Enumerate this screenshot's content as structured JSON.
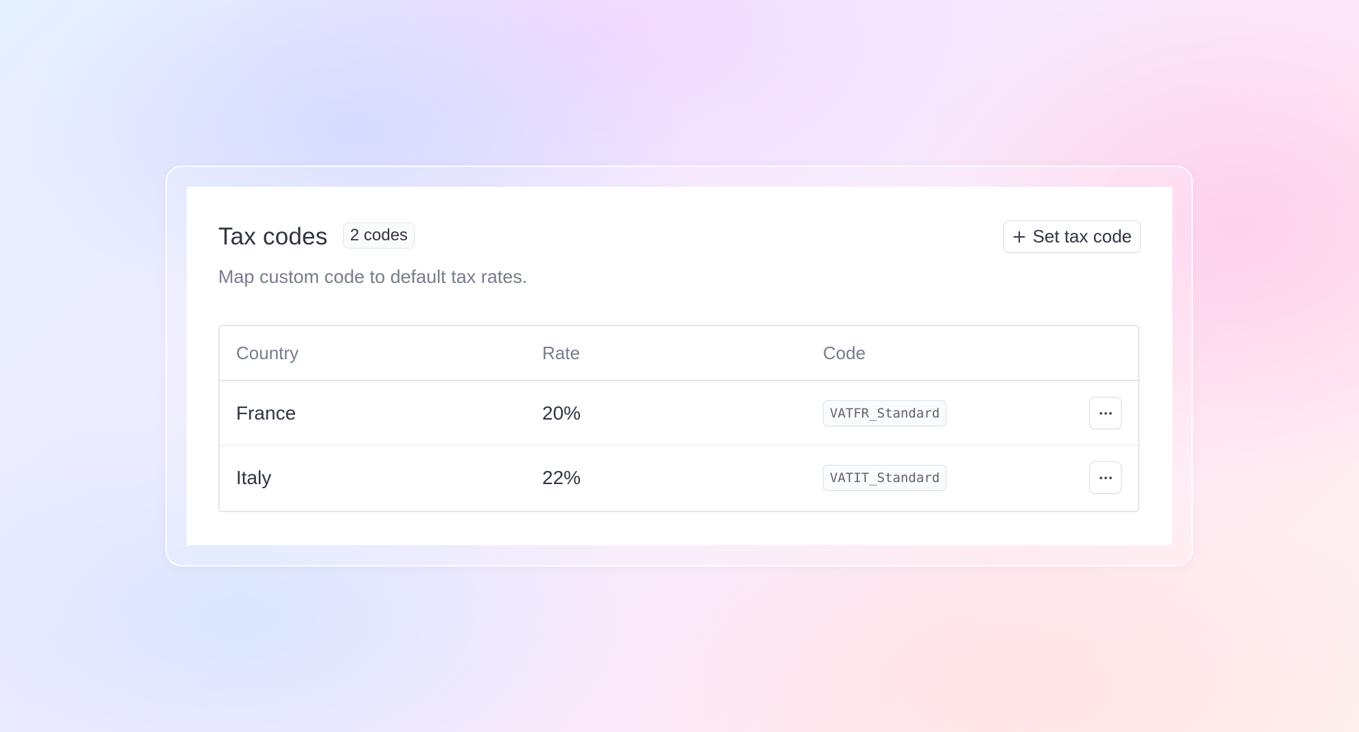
{
  "header": {
    "title": "Tax codes",
    "count_badge": "2 codes",
    "subtitle": "Map custom code to default tax rates.",
    "add_button_label": "Set tax code",
    "add_icon": "plus-icon"
  },
  "table": {
    "columns": [
      "Country",
      "Rate",
      "Code"
    ],
    "rows": [
      {
        "country": "France",
        "rate": "20%",
        "code": "VATFR_Standard",
        "menu_icon": "ellipsis-icon"
      },
      {
        "country": "Italy",
        "rate": "22%",
        "code": "VATIT_Standard",
        "menu_icon": "ellipsis-icon"
      }
    ]
  },
  "colors": {
    "text_primary": "#2f3542",
    "text_muted": "#767d8c",
    "border": "#e3e6eb",
    "surface": "#ffffff"
  }
}
